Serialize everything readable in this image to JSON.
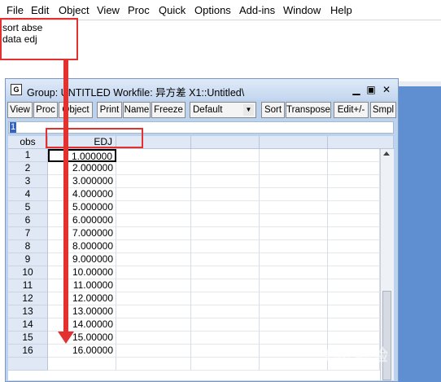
{
  "menu": [
    "File",
    "Edit",
    "Object",
    "View",
    "Proc",
    "Quick",
    "Options",
    "Add-ins",
    "Window",
    "Help"
  ],
  "commands": [
    "sort abse",
    "data edj"
  ],
  "window": {
    "icon_letter": "G",
    "title": "Group: UNTITLED   Workfile: 异方差 X1::Untitled\\",
    "min": "▁",
    "max": "▣",
    "close": "✕"
  },
  "toolbar": {
    "view": "View",
    "proc": "Proc",
    "object": "Object",
    "print": "Print",
    "name": "Name",
    "freeze": "Freeze",
    "select_value": "Default",
    "sort": "Sort",
    "transpose": "Transpose",
    "editpm": "Edit+/-",
    "smpl": "Smpl"
  },
  "edit_value": "1",
  "table": {
    "obs_header": "obs",
    "col_header": "EDJ",
    "rows": [
      {
        "obs": "1",
        "value": "1.000000"
      },
      {
        "obs": "2",
        "value": "2.000000"
      },
      {
        "obs": "3",
        "value": "3.000000"
      },
      {
        "obs": "4",
        "value": "4.000000"
      },
      {
        "obs": "5",
        "value": "5.000000"
      },
      {
        "obs": "6",
        "value": "6.000000"
      },
      {
        "obs": "7",
        "value": "7.000000"
      },
      {
        "obs": "8",
        "value": "8.000000"
      },
      {
        "obs": "9",
        "value": "9.000000"
      },
      {
        "obs": "10",
        "value": "10.00000"
      },
      {
        "obs": "11",
        "value": "11.00000"
      },
      {
        "obs": "12",
        "value": "12.00000"
      },
      {
        "obs": "13",
        "value": "13.00000"
      },
      {
        "obs": "14",
        "value": "14.00000"
      },
      {
        "obs": "15",
        "value": "15.00000"
      },
      {
        "obs": "16",
        "value": "16.00000"
      },
      {
        "obs": "",
        "value": ""
      }
    ]
  },
  "watermark": "Bai 经验",
  "colors": {
    "annotation": "#e3312f",
    "selection": "#3464c0",
    "desktop": "#5f8fd0"
  }
}
